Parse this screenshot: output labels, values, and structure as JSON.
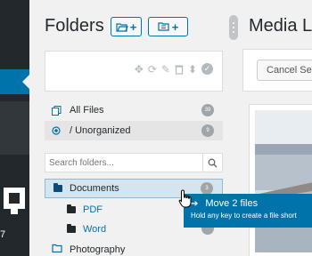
{
  "sidebar_strip": {
    "count_label": "7"
  },
  "panel": {
    "title": "Folders",
    "new_folder_button": {
      "icon": "folder-open-plus-icon",
      "label": "+"
    },
    "new_category_button": {
      "icon": "folder-tree-plus-icon",
      "label": "+"
    },
    "toolbar_icons": [
      "move-icon",
      "refresh-icon",
      "edit-icon",
      "delete-icon",
      "sort-icon",
      "check-circle-icon"
    ]
  },
  "quick_links": [
    {
      "label": "All Files",
      "count": "39",
      "icon": "files-icon"
    },
    {
      "label": "/ Unorganized",
      "count": "9",
      "icon": "radio-icon"
    }
  ],
  "search": {
    "placeholder": "Search folders..."
  },
  "tree": [
    {
      "label": "Documents",
      "count": "3",
      "level": 0,
      "selected": true
    },
    {
      "label": "PDF",
      "count": "",
      "level": 1
    },
    {
      "label": "Word",
      "count": "",
      "level": 1
    },
    {
      "label": "Photography",
      "count": "",
      "level": 0
    }
  ],
  "media": {
    "title": "Media Li",
    "cancel_button": "Cancel Sel"
  },
  "drag_tooltip": {
    "title": "Move 2 files",
    "hint": "Hold any key to create a file short"
  },
  "colors": {
    "accent": "#0073aa",
    "admin_dark": "#23282d",
    "selected_row": "#d4e5f0"
  }
}
